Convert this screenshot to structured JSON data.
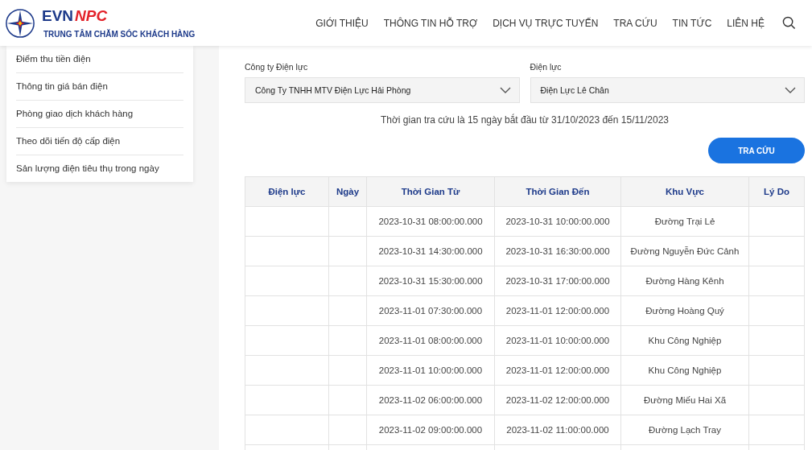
{
  "header": {
    "logo": {
      "brand_a": "EVN",
      "brand_b": "NPC",
      "subtitle": "TRUNG TÂM CHĂM SÓC KHÁCH HÀNG"
    },
    "nav": [
      "GIỚI THIỆU",
      "THÔNG TIN HỖ TRỢ",
      "DỊCH VỤ TRỰC TUYẾN",
      "TRA CỨU",
      "TIN TỨC",
      "LIÊN HỆ"
    ]
  },
  "sidebar": {
    "items": [
      "Điểm thu tiền điện",
      "Thông tin giá bán điện",
      "Phòng giao dịch khách hàng",
      "Theo dõi tiến độ cấp điện",
      "Sản lượng điện tiêu thụ trong ngày"
    ]
  },
  "form": {
    "fields": [
      {
        "label": "Công ty Điện lực",
        "value": "Công Ty TNHH MTV Điện Lực Hải Phòng"
      },
      {
        "label": "Điện lực",
        "value": "Điện Lực Lê Chân"
      }
    ],
    "note": "Thời gian tra cứu là 15 ngày bắt đầu từ 31/10/2023 đến 15/11/2023",
    "button": "TRA CỨU"
  },
  "table": {
    "columns": [
      "Điện lực",
      "Ngày",
      "Thời Gian Từ",
      "Thời Gian Đến",
      "Khu Vực",
      "Lý Do"
    ],
    "rows": [
      {
        "from": "2023-10-31 08:00:00.000",
        "to": "2023-10-31 10:00:00.000",
        "area": "Đường Trại Lẻ"
      },
      {
        "from": "2023-10-31 14:30:00.000",
        "to": "2023-10-31 16:30:00.000",
        "area": "Đường Nguyễn Đức Cảnh"
      },
      {
        "from": "2023-10-31 15:30:00.000",
        "to": "2023-10-31 17:00:00.000",
        "area": "Đường Hàng Kênh"
      },
      {
        "from": "2023-11-01 07:30:00.000",
        "to": "2023-11-01 12:00:00.000",
        "area": "Đường Hoàng Quý"
      },
      {
        "from": "2023-11-01 08:00:00.000",
        "to": "2023-11-01 10:00:00.000",
        "area": "Khu Công Nghiệp"
      },
      {
        "from": "2023-11-01 10:00:00.000",
        "to": "2023-11-01 12:00:00.000",
        "area": "Khu Công Nghiệp"
      },
      {
        "from": "2023-11-02 06:00:00.000",
        "to": "2023-11-02 12:00:00.000",
        "area": "Đường Miếu Hai Xã"
      },
      {
        "from": "2023-11-02 09:00:00.000",
        "to": "2023-11-02 11:00:00.000",
        "area": "Đường Lạch Tray"
      }
    ]
  }
}
